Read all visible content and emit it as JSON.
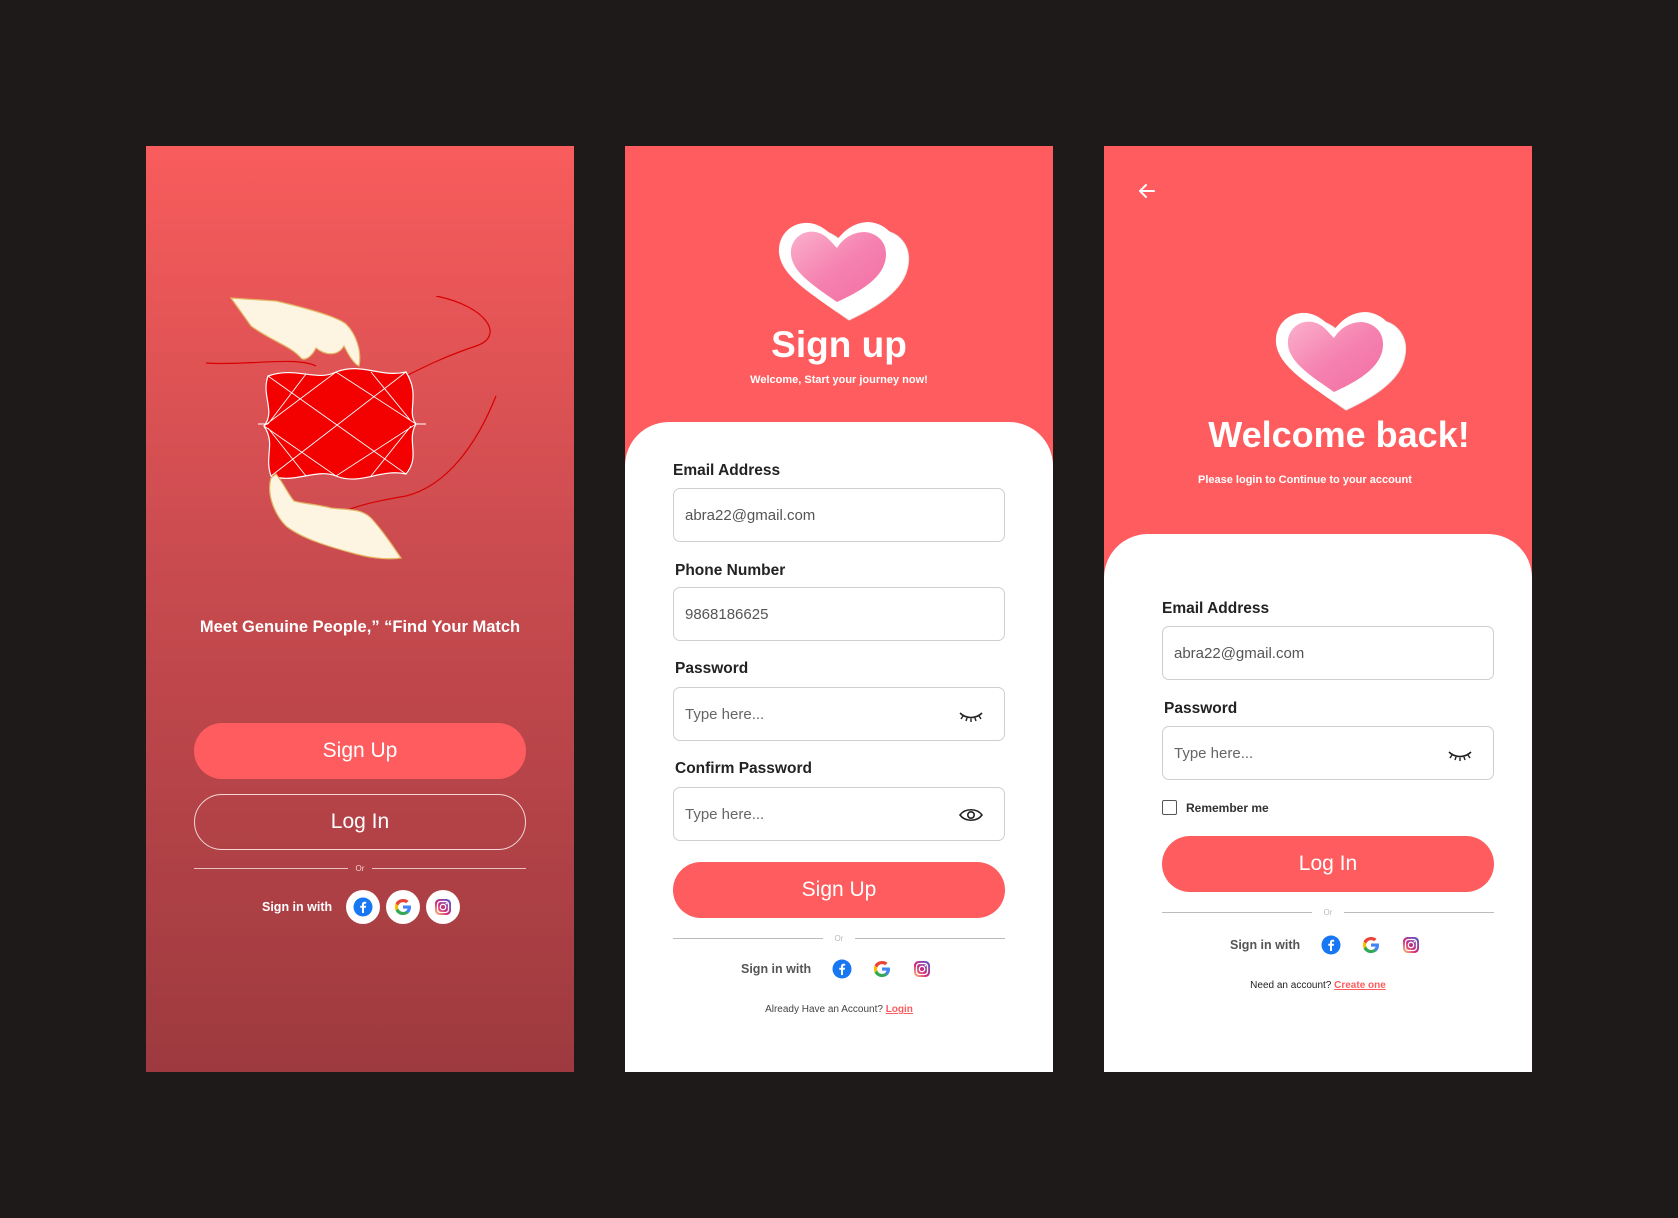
{
  "screen1": {
    "tagline": "Meet Genuine People,” “Find Your Match",
    "signup_label": "Sign Up",
    "login_label": "Log In",
    "or_text": "Or",
    "sign_in_with": "Sign in with",
    "social_icons": [
      "facebook-icon",
      "google-icon",
      "instagram-icon"
    ]
  },
  "screen2": {
    "title": "Sign up",
    "subtitle": "Welcome, Start your journey now!",
    "email_label": "Email Address",
    "email_value": "abra22@gmail.com",
    "phone_label": "Phone Number",
    "phone_value": "9868186625",
    "password_label": "Password",
    "password_placeholder": "Type here...",
    "confirm_label": "Confirm Password",
    "confirm_placeholder": "Type here...",
    "signup_label": "Sign Up",
    "or_text": "Or",
    "sign_in_with": "Sign in with",
    "already_text": "Already Have an Account?",
    "login_link": "Login"
  },
  "screen3": {
    "title": "Welcome back!",
    "subtitle": "Please login to Continue to your account",
    "email_label": "Email Address",
    "email_value": "abra22@gmail.com",
    "password_label": "Password",
    "password_placeholder": "Type here...",
    "remember_label": "Remember me",
    "login_label": "Log In",
    "or_text": "Or",
    "sign_in_with": "Sign in with",
    "need_account_text": "Need an account?",
    "create_link": "Create one"
  },
  "colors": {
    "accent": "#fe5c5e",
    "background": "#1e1a1a",
    "heart_pink": "#f88db6",
    "illustration_red": "#f30000"
  }
}
